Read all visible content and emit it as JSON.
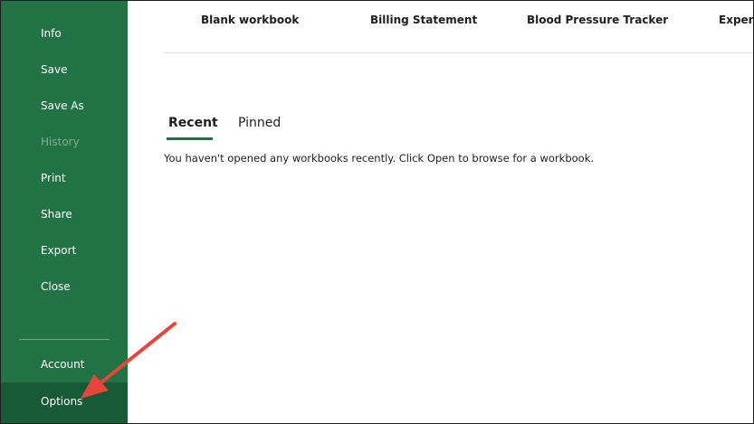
{
  "sidebar": {
    "items": [
      {
        "label": "Info"
      },
      {
        "label": "Save"
      },
      {
        "label": "Save As"
      },
      {
        "label": "History"
      },
      {
        "label": "Print"
      },
      {
        "label": "Share"
      },
      {
        "label": "Export"
      },
      {
        "label": "Close"
      }
    ],
    "bottom_items": [
      {
        "label": "Account"
      },
      {
        "label": "Options"
      }
    ]
  },
  "templates": [
    {
      "label": "Blank workbook"
    },
    {
      "label": "Billing Statement"
    },
    {
      "label": "Blood Pressure Tracker"
    },
    {
      "label": "Expens"
    }
  ],
  "files": {
    "tabs": [
      {
        "label": "Recent"
      },
      {
        "label": "Pinned"
      }
    ],
    "empty_message": "You haven't opened any workbooks recently. Click Open to browse for a workbook."
  },
  "colors": {
    "brand_green": "#217346",
    "active_item": "#175a36",
    "annotation_arrow": "#e8443a"
  }
}
